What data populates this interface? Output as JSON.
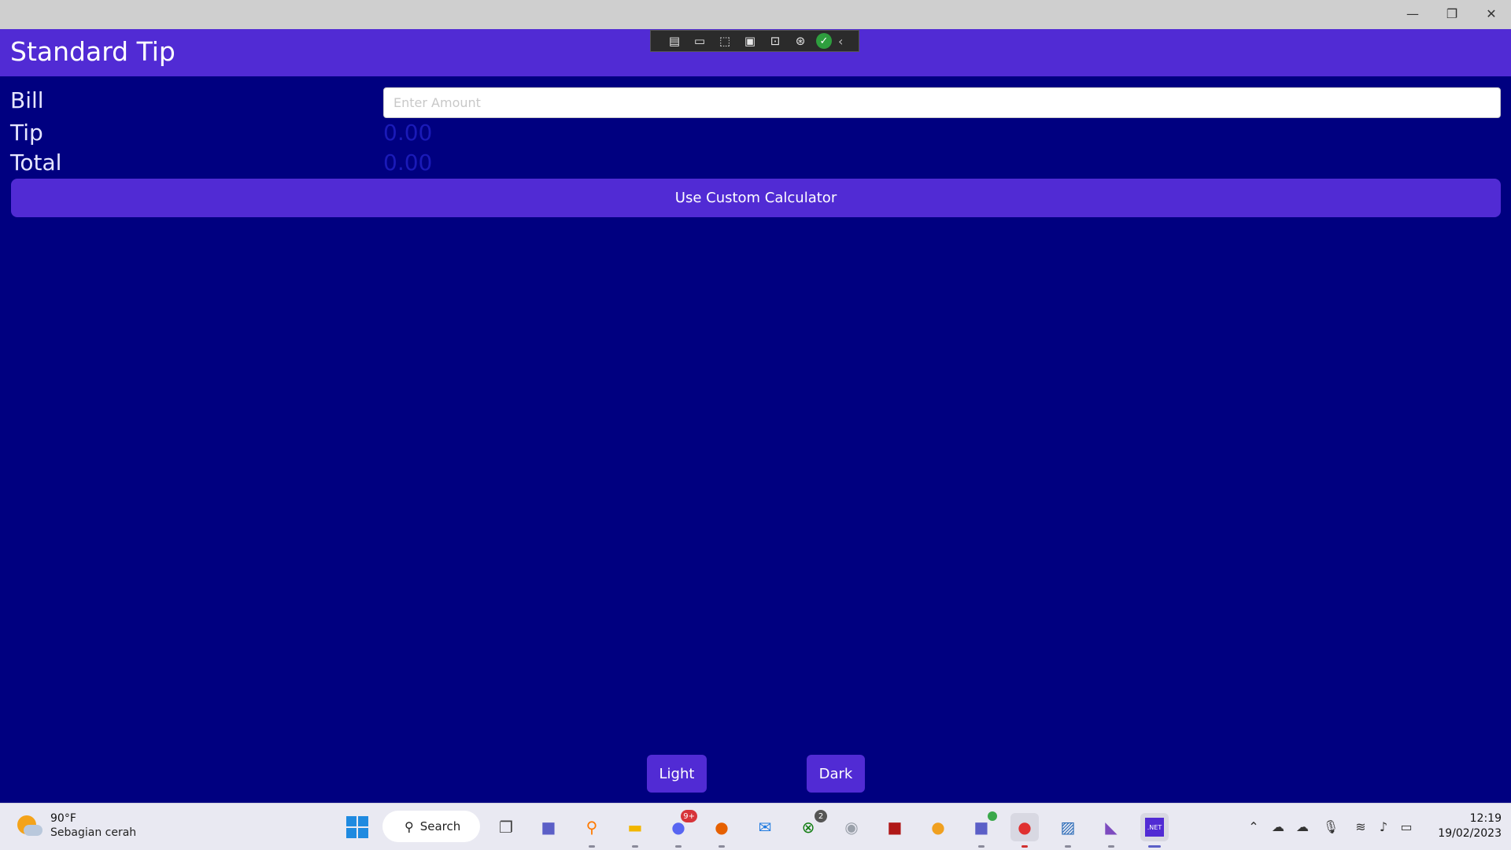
{
  "window": {
    "minimize_glyph": "—",
    "maximize_glyph": "❐",
    "close_glyph": "✕"
  },
  "header": {
    "title": "Standard Tip",
    "background": "#512BD4"
  },
  "debug_toolbar": {
    "icons": [
      "live-visual-tree-icon",
      "video-icon",
      "select-element-icon",
      "display-layout-adorners-icon",
      "track-focus-icon",
      "binding-failures-icon",
      "check-icon",
      "collapse-icon"
    ]
  },
  "form": {
    "bill_label": "Bill",
    "bill_placeholder": "Enter Amount",
    "bill_value": "",
    "tip_label": "Tip",
    "tip_value": "0.00",
    "total_label": "Total",
    "total_value": "0.00"
  },
  "buttons": {
    "custom_calculator": "Use Custom Calculator",
    "light": "Light",
    "dark": "Dark"
  },
  "colors": {
    "page_background": "#000080",
    "accent": "#512BD4",
    "value_text": "#1A1AB8"
  },
  "taskbar": {
    "weather_temp": "90°F",
    "weather_desc": "Sebagian cerah",
    "search_label": "Search",
    "discord_badge": "9+",
    "xbox_badge": "2",
    "clock_time": "12:19",
    "clock_date": "19/02/2023",
    "dotnet_label": ".NET"
  }
}
